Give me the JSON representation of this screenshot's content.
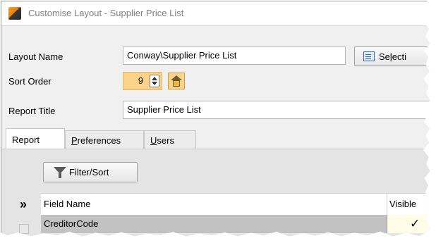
{
  "window": {
    "title": "Customise Layout - Supplier Price List"
  },
  "form": {
    "layout_name_label": "Layout Name",
    "layout_name_value": "Conway\\Supplier Price List",
    "select_button_label_pre": "Se",
    "select_button_label_accel": "l",
    "select_button_label_post": "ecti",
    "sort_order_label": "Sort Order",
    "sort_order_value": "9",
    "report_title_label": "Report Title",
    "report_title_value": "Supplier Price List"
  },
  "tabs": [
    {
      "label": "Report",
      "active": true
    },
    {
      "label_accel": "P",
      "label_rest": "references",
      "active": false
    },
    {
      "label_accel": "U",
      "label_rest": "sers",
      "active": false
    }
  ],
  "panel": {
    "filter_button_label": "Filter/Sort",
    "expand_glyph": "»",
    "columns": [
      "Field Name",
      "Visible"
    ],
    "rows": [
      {
        "field_name": "CreditorCode",
        "visible_mark": "✓"
      }
    ]
  },
  "colors": {
    "highlight": "#fbd38a",
    "selected_row": "#c2c2c2",
    "title_text": "#808080"
  }
}
